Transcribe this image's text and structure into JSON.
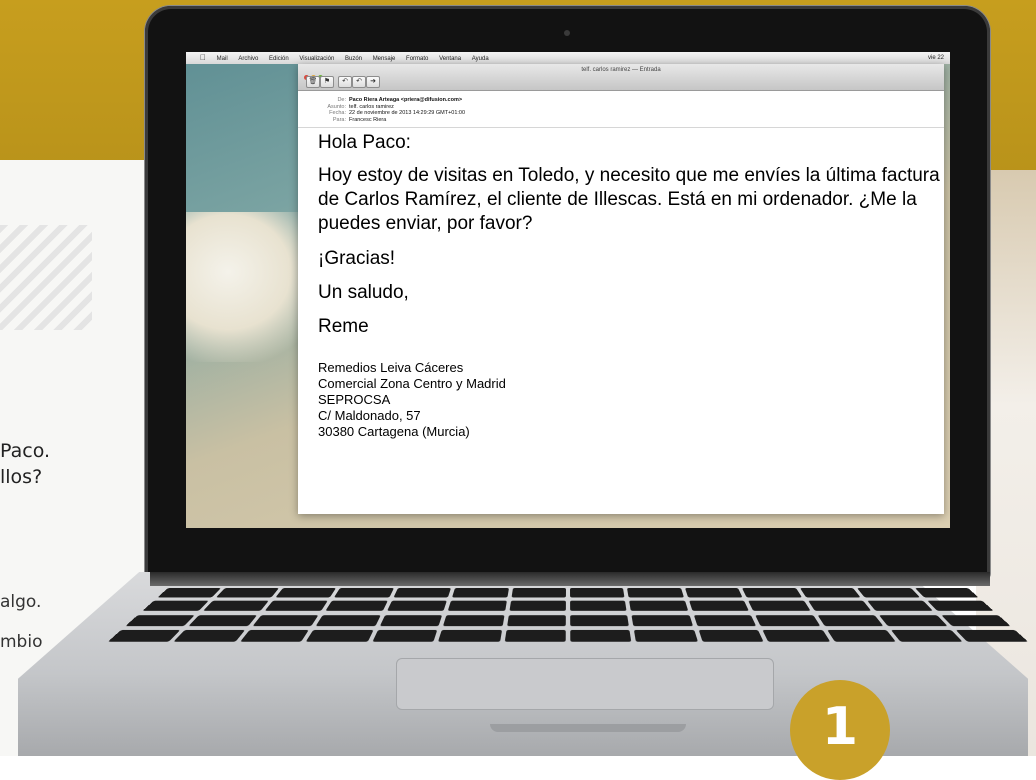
{
  "menubar": {
    "items": [
      "Mail",
      "Archivo",
      "Edición",
      "Visualización",
      "Buzón",
      "Mensaje",
      "Formato",
      "Ventana",
      "Ayuda"
    ],
    "status": "vie 22"
  },
  "window": {
    "title": "telf. carlos ramirez — Entrada"
  },
  "headers": {
    "from_label": "De:",
    "from": "Paco Riera Arteaga <priera@difusion.com>",
    "subject_label": "Asunto:",
    "subject": "telf. carlos ramirez",
    "date_label": "Fecha:",
    "date": "22 de noviembre de 2013 14:29:29 GMT+01:00",
    "to_label": "Para:",
    "to": "Francesc Riera"
  },
  "message": {
    "greeting": "Hola Paco:",
    "paragraph": "Hoy estoy de visitas en Toledo, y necesito que me envíes la última factura de Carlos Ramírez, el cliente de Illescas. Está en mi ordenador. ¿Me la puedes enviar, por favor?",
    "thanks": "¡Gracias!",
    "closing": "Un saludo,",
    "name": "Reme",
    "signature": [
      "Remedios Leiva Cáceres",
      "Comercial Zona Centro y Madrid",
      "SEPROCSA",
      "C/ Maldonado, 57",
      "30380 Cartagena (Murcia)"
    ]
  },
  "side_text": {
    "line1": "Paco.",
    "line2": "llos?",
    "line3": "algo.",
    "line4": "mbio"
  },
  "badge": "1"
}
